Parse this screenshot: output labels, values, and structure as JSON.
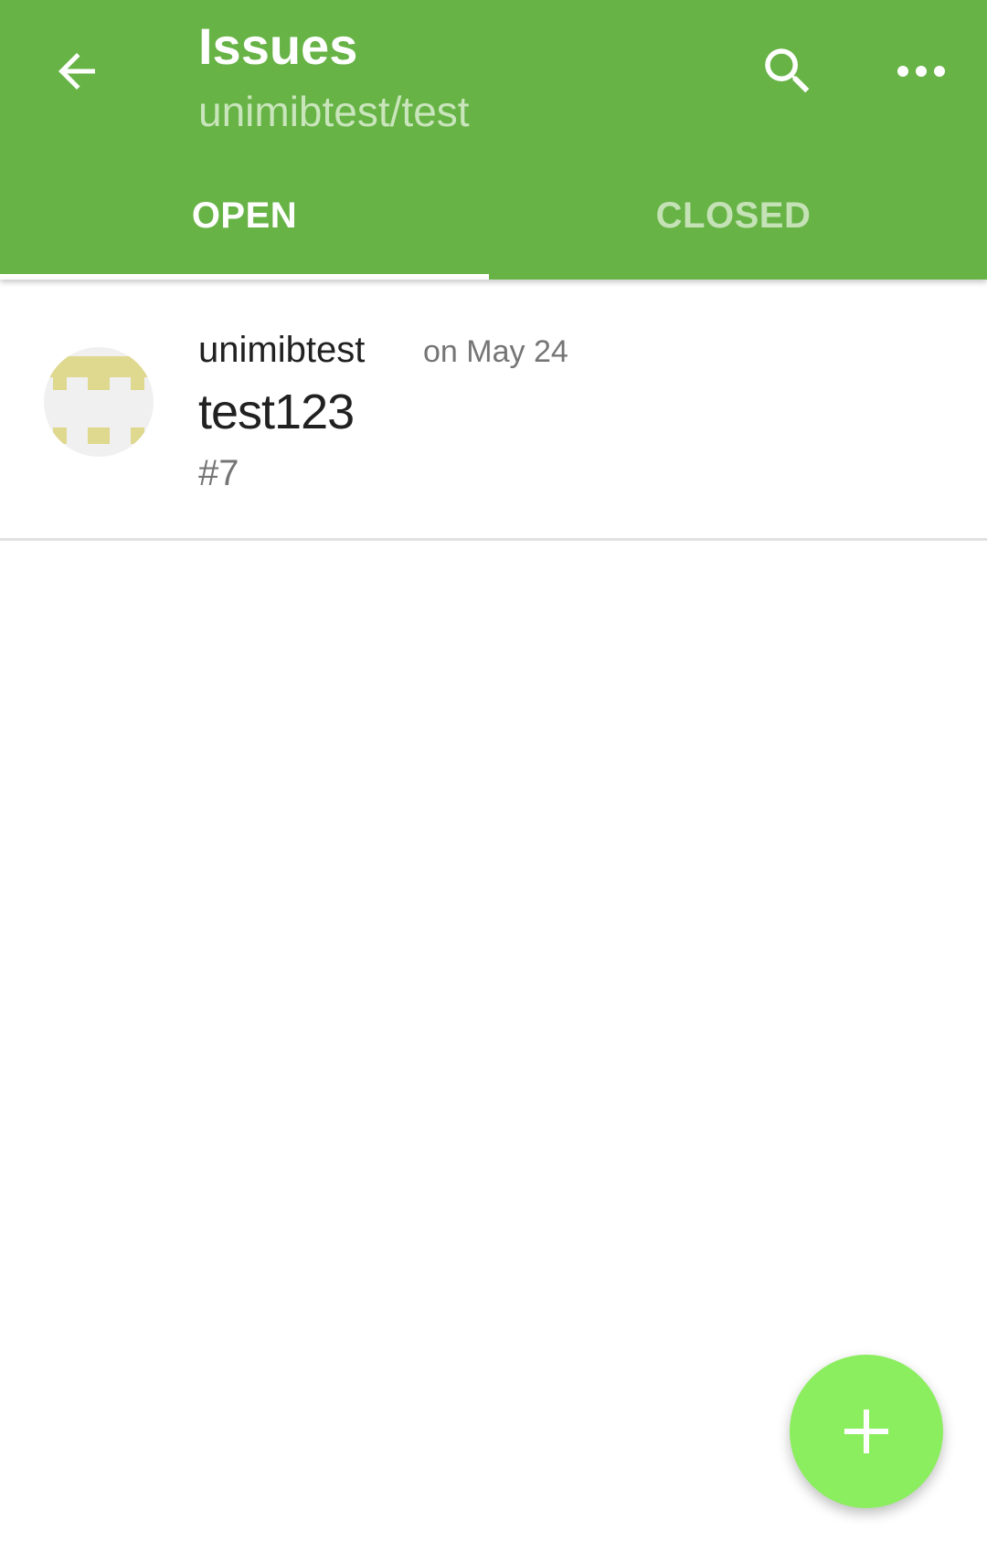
{
  "colors": {
    "appbar": "#67b346",
    "subtitle": "#c9e5bb",
    "tab_inactive": "#c4e2b5",
    "fab": "#8bee5e",
    "avatar_pattern": "#dfd88f"
  },
  "toolbar": {
    "title": "Issues",
    "subtitle": "unimibtest/test",
    "back_icon": "arrow-back-icon",
    "search_icon": "search-icon",
    "more_icon": "more-horizontal-icon"
  },
  "tabs": [
    {
      "label": "OPEN",
      "selected": true
    },
    {
      "label": "CLOSED",
      "selected": false
    }
  ],
  "issues": [
    {
      "author": "unimibtest",
      "date": "on May 24",
      "title": "test123",
      "number": "#7",
      "avatar_icon": "identicon-avatar"
    }
  ],
  "fab": {
    "icon": "plus-icon"
  }
}
